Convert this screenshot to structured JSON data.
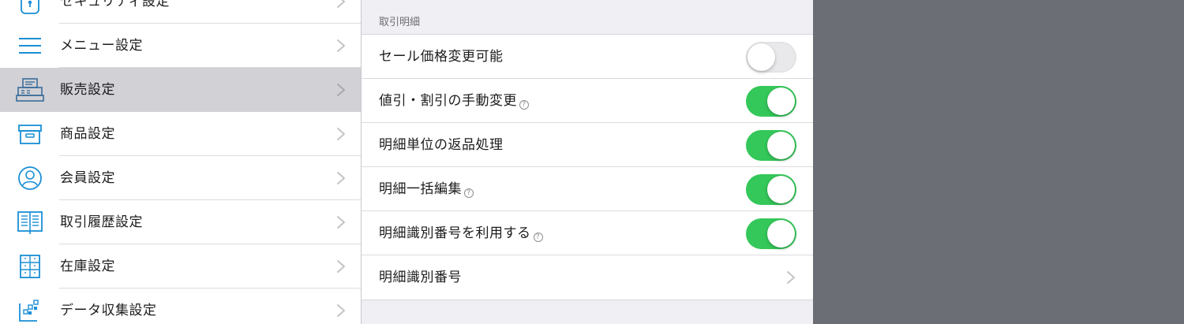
{
  "sidebar": {
    "items": [
      {
        "label": "セキュリティ設定",
        "icon": "lock-icon",
        "selected": false
      },
      {
        "label": "メニュー設定",
        "icon": "menu-icon",
        "selected": false
      },
      {
        "label": "販売設定",
        "icon": "register-icon",
        "selected": true
      },
      {
        "label": "商品設定",
        "icon": "box-icon",
        "selected": false
      },
      {
        "label": "会員設定",
        "icon": "user-icon",
        "selected": false
      },
      {
        "label": "取引履歴設定",
        "icon": "book-icon",
        "selected": false
      },
      {
        "label": "在庫設定",
        "icon": "shelves-icon",
        "selected": false
      },
      {
        "label": "データ収集設定",
        "icon": "data-icon",
        "selected": false
      }
    ]
  },
  "detail": {
    "section_header": "取引明細",
    "help_glyph": "?",
    "rows": [
      {
        "label": "セール価格変更可能",
        "type": "toggle",
        "on": false
      },
      {
        "label": "値引・割引の手動変更",
        "type": "toggle",
        "on": true,
        "help": true
      },
      {
        "label": "明細単位の返品処理",
        "type": "toggle",
        "on": true
      },
      {
        "label": "明細一括編集",
        "type": "toggle",
        "on": true,
        "help": true
      },
      {
        "label": "明細識別番号を利用する",
        "type": "toggle",
        "on": true,
        "help": true
      },
      {
        "label": "明細識別番号",
        "type": "disclosure"
      }
    ]
  },
  "colors": {
    "accent_icon": "#1a8fd6",
    "toggle_on": "#34c759",
    "selected_row": "#d1d1d6",
    "background_dim": "#6c6e75"
  }
}
